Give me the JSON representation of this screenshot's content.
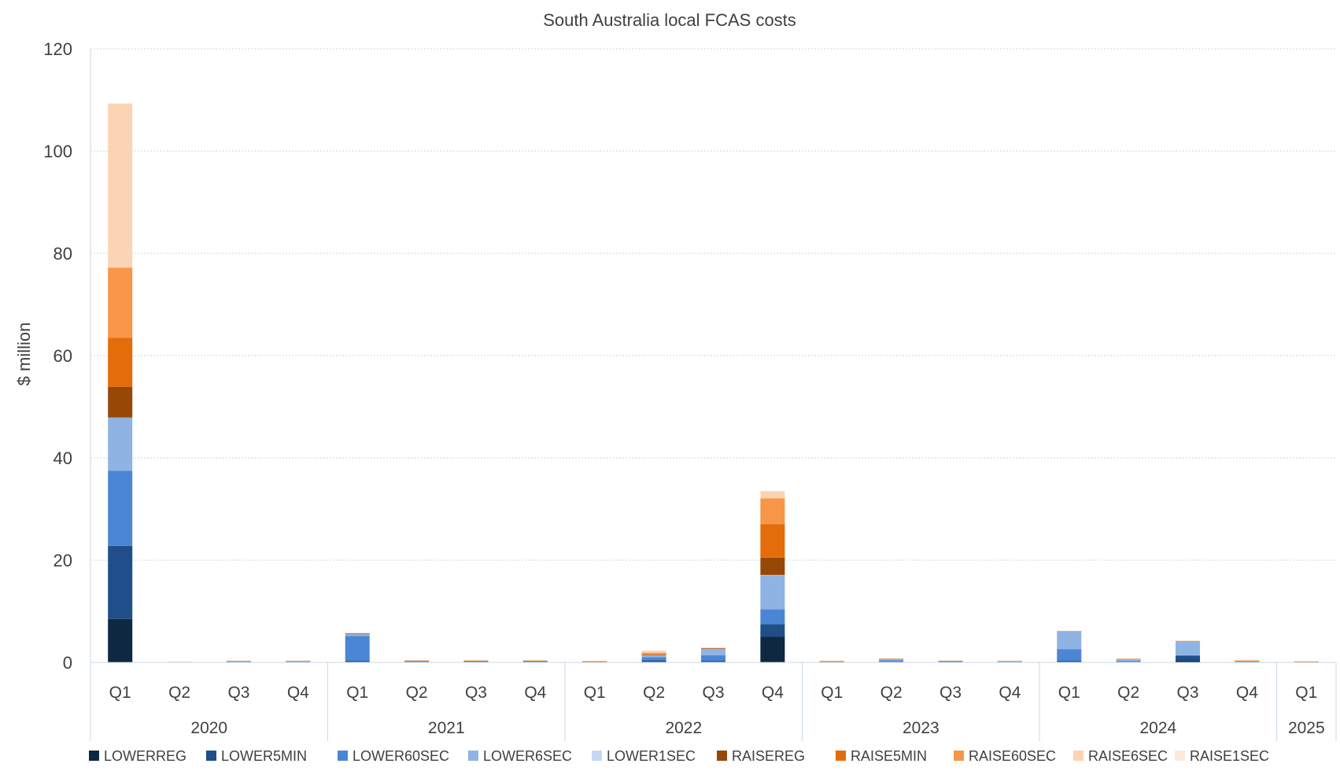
{
  "chart_data": {
    "type": "bar",
    "stacked": true,
    "title": "South Australia local FCAS costs",
    "ylabel": "$ million",
    "xlabel": "",
    "ylim": [
      0,
      120
    ],
    "yticks": [
      0,
      20,
      40,
      60,
      80,
      100,
      120
    ],
    "grid": true,
    "legend_position": "bottom",
    "years": [
      {
        "label": "2020",
        "quarters": 4
      },
      {
        "label": "2021",
        "quarters": 4
      },
      {
        "label": "2022",
        "quarters": 4
      },
      {
        "label": "2023",
        "quarters": 4
      },
      {
        "label": "2024",
        "quarters": 4
      },
      {
        "label": "2025",
        "quarters": 1
      }
    ],
    "categories": [
      "Q1",
      "Q2",
      "Q3",
      "Q4",
      "Q1",
      "Q2",
      "Q3",
      "Q4",
      "Q1",
      "Q2",
      "Q3",
      "Q4",
      "Q1",
      "Q2",
      "Q3",
      "Q4",
      "Q1",
      "Q2",
      "Q3",
      "Q4",
      "Q1"
    ],
    "series": [
      {
        "name": "LOWERREG",
        "color": "#0e2841",
        "values": [
          8.5,
          0.05,
          0.05,
          0.05,
          0.1,
          0.05,
          0.05,
          0.05,
          0.05,
          0.1,
          0.1,
          5.0,
          0.05,
          0.05,
          0.05,
          0.05,
          0.1,
          0.05,
          0.3,
          0.05,
          0.05
        ]
      },
      {
        "name": "LOWER5MIN",
        "color": "#1f4e89",
        "values": [
          14.3,
          0.02,
          0.05,
          0.05,
          0.2,
          0.05,
          0.05,
          0.05,
          0.02,
          0.3,
          0.2,
          2.5,
          0.02,
          0.05,
          0.05,
          0.05,
          0.2,
          0.05,
          1.0,
          0.05,
          0.02
        ]
      },
      {
        "name": "LOWER60SEC",
        "color": "#4a86d4",
        "values": [
          14.7,
          0.02,
          0.15,
          0.15,
          4.9,
          0.15,
          0.2,
          0.2,
          0.05,
          0.6,
          1.1,
          2.9,
          0.05,
          0.3,
          0.15,
          0.1,
          2.3,
          0.2,
          0.1,
          0.05,
          0.05
        ]
      },
      {
        "name": "LOWER6SEC",
        "color": "#8fb4e3",
        "values": [
          10.4,
          0.02,
          0.05,
          0.05,
          0.4,
          0.1,
          0.05,
          0.05,
          0.02,
          0.4,
          1.3,
          6.6,
          0.05,
          0.3,
          0.05,
          0.05,
          3.4,
          0.3,
          2.7,
          0.05,
          0.02
        ]
      },
      {
        "name": "LOWER1SEC",
        "color": "#c5d9f1",
        "values": [
          0,
          0,
          0,
          0,
          0,
          0,
          0,
          0,
          0,
          0,
          0,
          0.1,
          0.02,
          0.02,
          0.02,
          0.02,
          0.1,
          0.1,
          0.1,
          0.05,
          0.02
        ]
      },
      {
        "name": "RAISEREG",
        "color": "#974706",
        "values": [
          6.0,
          0.01,
          0.01,
          0.01,
          0.05,
          0.02,
          0.02,
          0.02,
          0.02,
          0.1,
          0.05,
          3.4,
          0.02,
          0.02,
          0.02,
          0.02,
          0.02,
          0.02,
          0.02,
          0.02,
          0.02
        ]
      },
      {
        "name": "RAISE5MIN",
        "color": "#e46c0a",
        "values": [
          9.6,
          0.01,
          0.01,
          0.01,
          0.05,
          0.02,
          0.02,
          0.02,
          0.02,
          0.1,
          0.05,
          6.5,
          0.02,
          0.02,
          0.02,
          0.02,
          0.02,
          0.02,
          0.02,
          0.02,
          0.02
        ]
      },
      {
        "name": "RAISE60SEC",
        "color": "#f79646",
        "values": [
          13.7,
          0.01,
          0.01,
          0.01,
          0.05,
          0.02,
          0.02,
          0.02,
          0.05,
          0.3,
          0.05,
          5.1,
          0.05,
          0.02,
          0.02,
          0.02,
          0.02,
          0.02,
          0.02,
          0.05,
          0.02
        ]
      },
      {
        "name": "RAISE6SEC",
        "color": "#fbd4b4",
        "values": [
          32.1,
          0.01,
          0.01,
          0.01,
          0.05,
          0.02,
          0.02,
          0.02,
          0.1,
          0.4,
          0.05,
          1.4,
          0.1,
          0.02,
          0.02,
          0.02,
          0.02,
          0.02,
          0.02,
          0.2,
          0.05
        ]
      },
      {
        "name": "RAISE1SEC",
        "color": "#fde9d9",
        "values": [
          0,
          0,
          0,
          0,
          0,
          0,
          0,
          0,
          0,
          0,
          0,
          0.05,
          0.02,
          0.02,
          0.02,
          0.02,
          0.02,
          0.02,
          0.02,
          0.05,
          0.02
        ]
      }
    ]
  }
}
